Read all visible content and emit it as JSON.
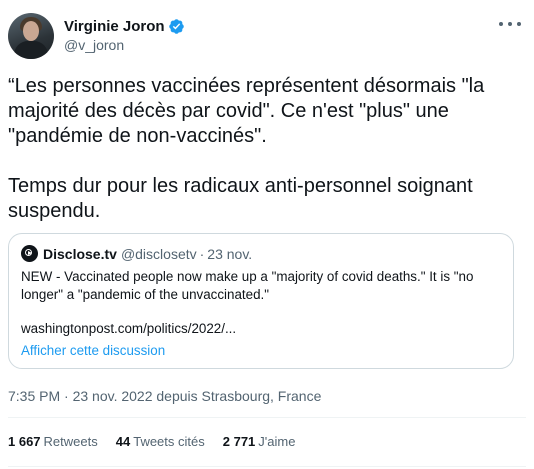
{
  "author": {
    "name": "Virginie Joron",
    "handle": "@v_joron",
    "verified_icon": "verified-badge-icon",
    "verified_color": "#1d9bf0"
  },
  "tweet": {
    "text": "“Les personnes vaccinées représentent désormais \"la majorité des décès par covid\". Ce n'est \"plus\" une \"pandémie de non-vaccinés\".\n\nTemps dur pour les radicaux anti-personnel soignant suspendu.",
    "meta": "7:35 PM · 23 nov. 2022 depuis Strasbourg, France"
  },
  "quote": {
    "name": "Disclose.tv",
    "handle": "@disclosetv",
    "separator": "·",
    "date": "23 nov.",
    "text": "NEW - Vaccinated people now make up a \"majority of covid deaths.\" It is \"no longer\" a \"pandemic of the unvaccinated.\"",
    "link": "washingtonpost.com/politics/2022/...",
    "show_thread": "Afficher cette discussion"
  },
  "stats": {
    "retweets_count": "1 667",
    "retweets_label": "Retweets",
    "quotes_count": "44",
    "quotes_label": "Tweets cités",
    "likes_count": "2 771",
    "likes_label": "J'aime"
  },
  "colors": {
    "accent": "#1d9bf0",
    "text": "#0f1419",
    "secondary": "#536471",
    "border": "#cfd9de"
  }
}
